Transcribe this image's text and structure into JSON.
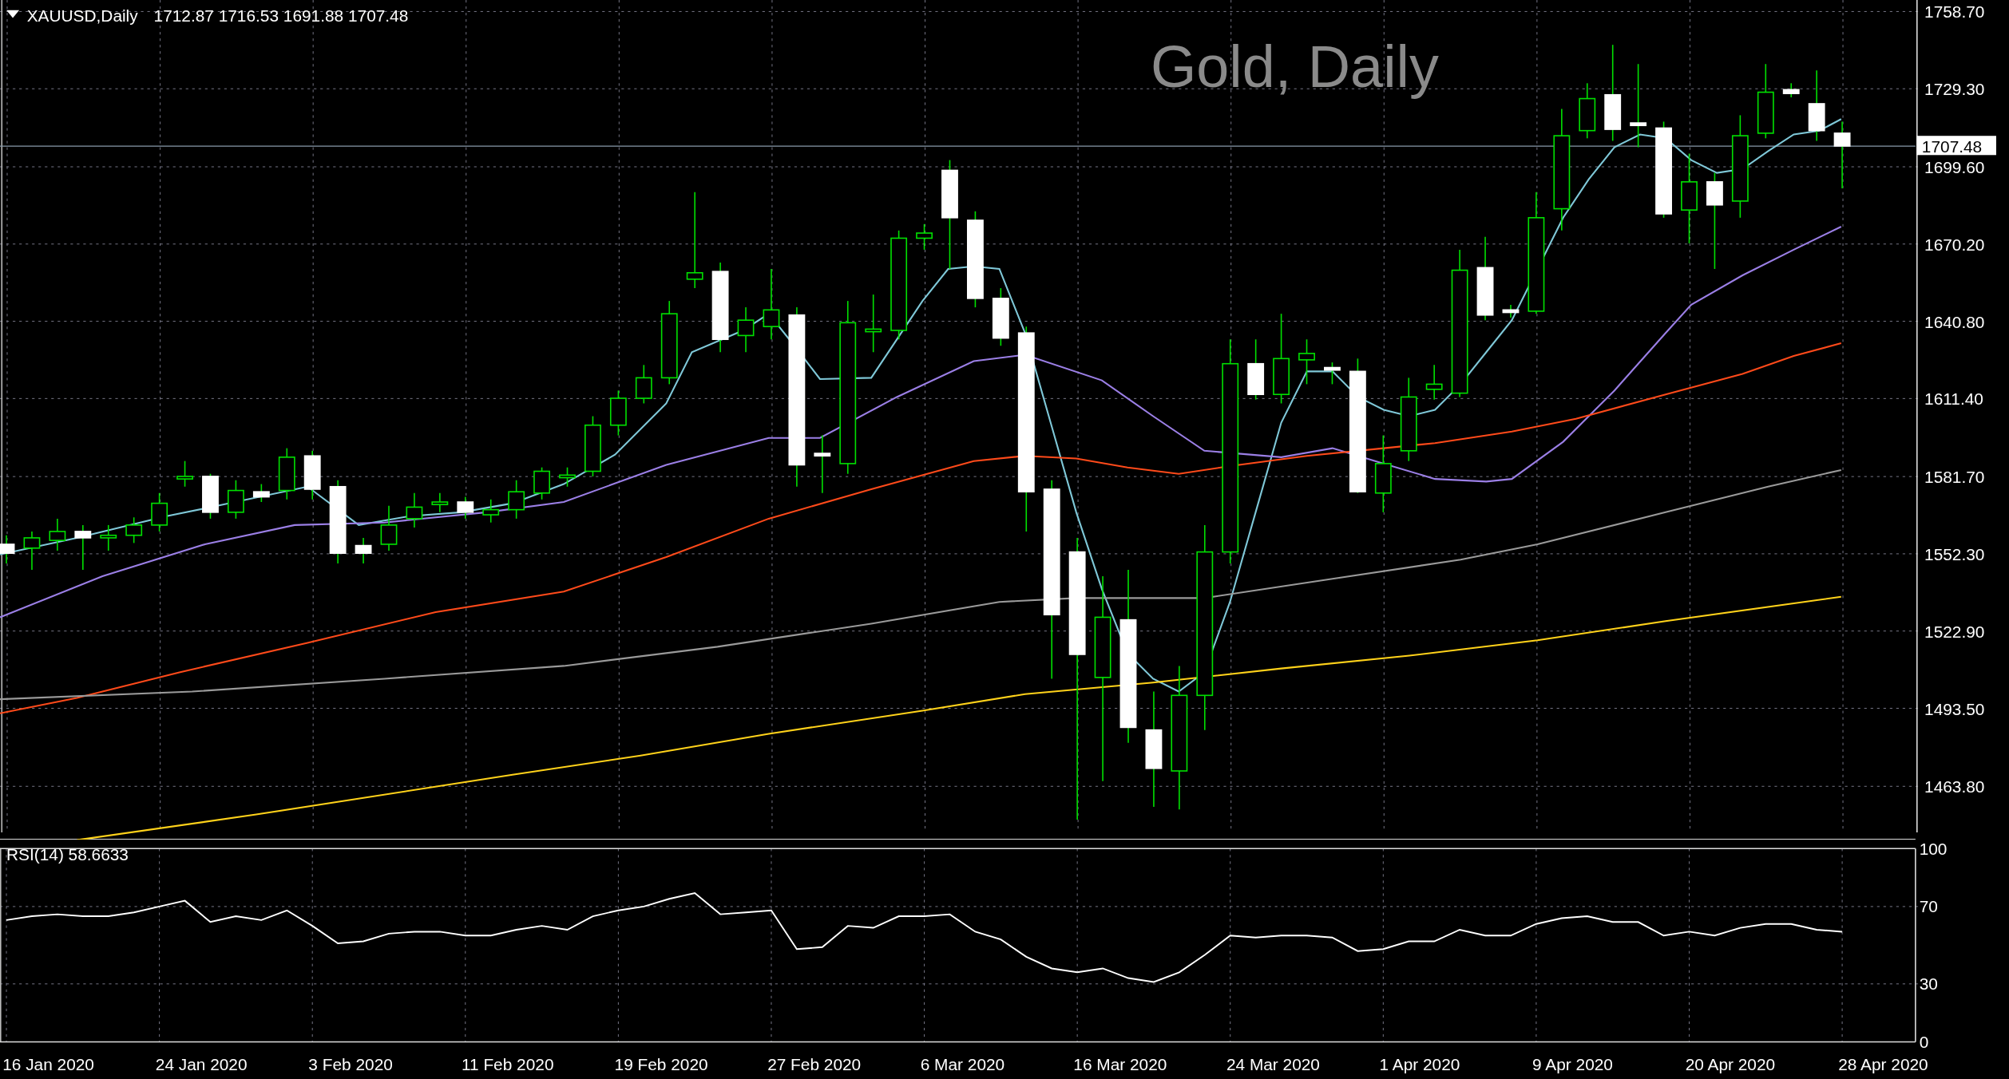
{
  "header": {
    "symbol": "XAUUSD,Daily",
    "ohlc": "1712.87 1716.53 1691.88 1707.48"
  },
  "price_chart": {
    "title": "Gold, Daily",
    "current_price": "1707.48",
    "axis_labels": [
      "1758.70",
      "1729.30",
      "1699.60",
      "1670.20",
      "1640.80",
      "1611.40",
      "1581.70",
      "1552.30",
      "1522.90",
      "1493.50",
      "1463.80"
    ]
  },
  "rsi": {
    "value": "58.6633",
    "chart_data": {
      "type": "line",
      "grid": true,
      "ylim": [
        0,
        100
      ],
      "yticks": [
        0,
        30,
        70,
        100
      ],
      "series": [
        {
          "name": "RSI(14)",
          "color": "#ffffff",
          "values": [
            63,
            65,
            66,
            65,
            65,
            67,
            70,
            73,
            62,
            65,
            63,
            68,
            60,
            51,
            52,
            56,
            57,
            57,
            55,
            55,
            58,
            60,
            58,
            65,
            68,
            70,
            74,
            77,
            66,
            67,
            68,
            48,
            49,
            60,
            59,
            65,
            65,
            66,
            57,
            53,
            44,
            38,
            36,
            38,
            33,
            31,
            36,
            45,
            55,
            54,
            55,
            55,
            54,
            47,
            48,
            52,
            52,
            58,
            55,
            55,
            61,
            64,
            65,
            62,
            62,
            55,
            57,
            55,
            59,
            61,
            61,
            58,
            57
          ]
        }
      ]
    }
  },
  "time_axis": {
    "labels": [
      "16 Jan 2020",
      "24 Jan 2020",
      "3 Feb 2020",
      "11 Feb 2020",
      "19 Feb 2020",
      "27 Feb 2020",
      "6 Mar 2020",
      "16 Mar 2020",
      "24 Mar 2020",
      "1 Apr 2020",
      "9 Apr 2020",
      "20 Apr 2020",
      "28 Apr 2020"
    ]
  }
}
